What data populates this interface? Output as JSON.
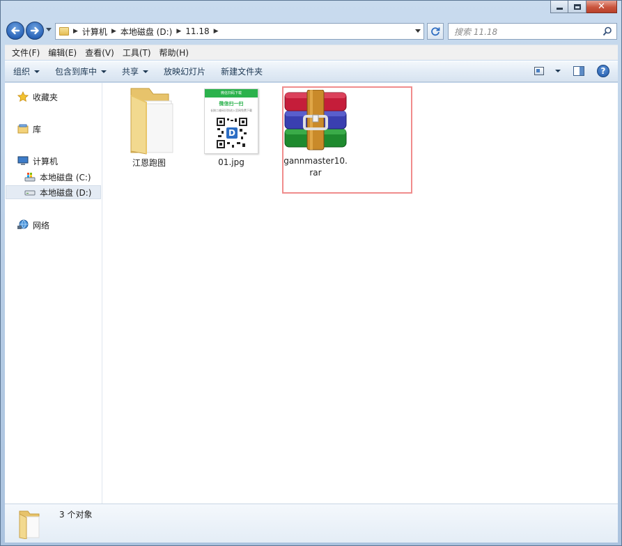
{
  "window": {
    "min_label": "",
    "max_label": "",
    "close_glyph": "✕"
  },
  "address": {
    "crumbs": [
      "计算机",
      "本地磁盘 (D:)",
      "11.18"
    ],
    "search_placeholder": "搜索 11.18"
  },
  "menu": [
    "文件(F)",
    "编辑(E)",
    "查看(V)",
    "工具(T)",
    "帮助(H)"
  ],
  "toolbar": {
    "organize": "组织",
    "include_in_library": "包含到库中",
    "share": "共享",
    "slideshow": "放映幻灯片",
    "new_folder": "新建文件夹"
  },
  "nav": {
    "favorites": "收藏夹",
    "library": "库",
    "computer": "计算机",
    "drive_c": "本地磁盘 (C:)",
    "drive_d": "本地磁盘 (D:)",
    "network": "网络"
  },
  "files": [
    {
      "name": "江恩跑图",
      "type": "folder"
    },
    {
      "name": "01.jpg",
      "type": "image"
    },
    {
      "name": "gannmaster10.rar",
      "type": "archive"
    }
  ],
  "thumb": {
    "header": "微信扫码下载",
    "title": "微信扫一扫",
    "caption": "长按二维码识别进入官网免费下载"
  },
  "status": {
    "count": "3 个对象"
  },
  "colors": {
    "selection_outline": "#f08c8c",
    "wechat_green": "#2bb24c",
    "window_frame": "#b4cbe4"
  }
}
